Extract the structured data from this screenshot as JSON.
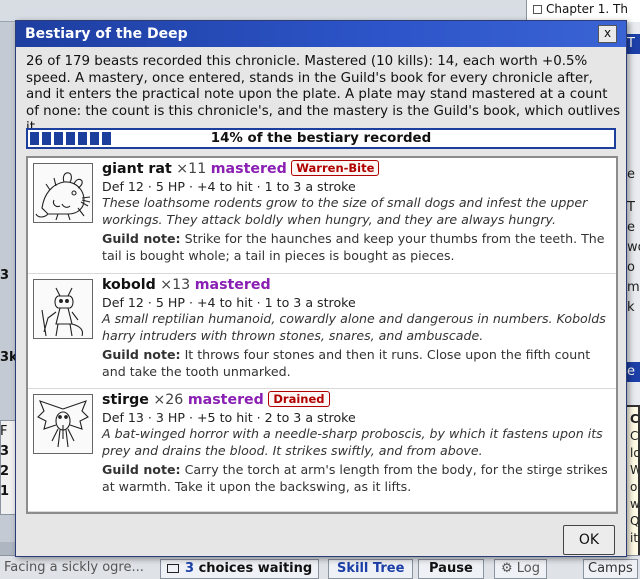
{
  "background": {
    "chapter_label": "Chapter 1. Th",
    "left_fragments": [
      "3",
      "3k",
      "F",
      "3",
      "2",
      "1"
    ],
    "right_fragments": [
      "T",
      "e",
      "T",
      "e",
      "wo",
      "o",
      "me",
      "k",
      "e"
    ],
    "tooltip_fragments": [
      "C",
      "C",
      "lo",
      "W",
      "o",
      "w",
      "Q",
      "it"
    ],
    "status_text": "Facing a sickly ogre...",
    "choices_count": "3",
    "choices_label": "choices waiting",
    "skill_tree_label": "Skill Tree",
    "pause_label": "Pause",
    "log_label": "Log",
    "camps_label": "Camps"
  },
  "modal": {
    "title": "Bestiary of the Deep",
    "close_label": "x",
    "intro": "26 of 179 beasts recorded this chronicle. Mastered (10 kills): 14, each worth +0.5% speed. A mastery, once entered, stands in the Guild's book for every chronicle after, and it enters the practical note upon the plate. A plate may stand mastered at a count of none: the count is this chronicle's, and the mastery is the Guild's book, which outlives it.",
    "progress": {
      "percent": 14,
      "label": "14% of the bestiary recorded"
    },
    "guild_note_label": "Guild note:",
    "entries": [
      {
        "name": "giant rat",
        "kills": "×11",
        "status": "mastered",
        "badge": "Warren-Bite",
        "stats": "Def 12 · 5 HP · +4 to hit · 1 to 3 a stroke",
        "description": "These loathsome rodents grow to the size of small dogs and infest the upper workings. They attack boldly when hungry, and they are always hungry.",
        "note": "Strike for the haunches and keep your thumbs from the teeth. The tail is bought whole; a tail in pieces is bought as pieces.",
        "portrait_icon": "rat-portrait-icon"
      },
      {
        "name": "kobold",
        "kills": "×13",
        "status": "mastered",
        "badge": "",
        "stats": "Def 12 · 5 HP · +4 to hit · 1 to 3 a stroke",
        "description": "A small reptilian humanoid, cowardly alone and dangerous in numbers. Kobolds harry intruders with thrown stones, snares, and ambuscade.",
        "note": "It throws four stones and then it runs. Close upon the fifth count and take the tooth unmarked.",
        "portrait_icon": "kobold-portrait-icon"
      },
      {
        "name": "stirge",
        "kills": "×26",
        "status": "mastered",
        "badge": "Drained",
        "stats": "Def 13 · 3 HP · +5 to hit · 2 to 3 a stroke",
        "description": "A bat-winged horror with a needle-sharp proboscis, by which it fastens upon its prey and drains the blood. It strikes swiftly, and from above.",
        "note": "Carry the torch at arm's length from the body, for the stirge strikes at warmth. Take it upon the backswing, as it lifts.",
        "portrait_icon": "stirge-portrait-icon"
      }
    ],
    "ok_label": "OK"
  }
}
